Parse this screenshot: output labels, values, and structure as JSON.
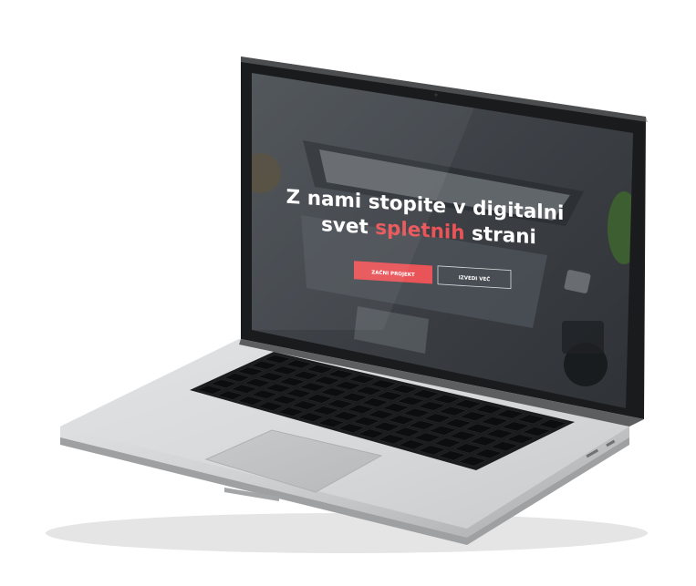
{
  "hero": {
    "line1": "Z nami stopite v digitalni",
    "line2_pre": "svet ",
    "line2_highlight": "spletnih",
    "line2_post": " strani"
  },
  "buttons": {
    "primary_label": "ZAČNI PROJEKT",
    "secondary_label": "IZVEDI VEČ"
  },
  "colors": {
    "accent": "#e85457",
    "hero_text": "#ffffff",
    "screen_overlay": "#3d4247"
  }
}
